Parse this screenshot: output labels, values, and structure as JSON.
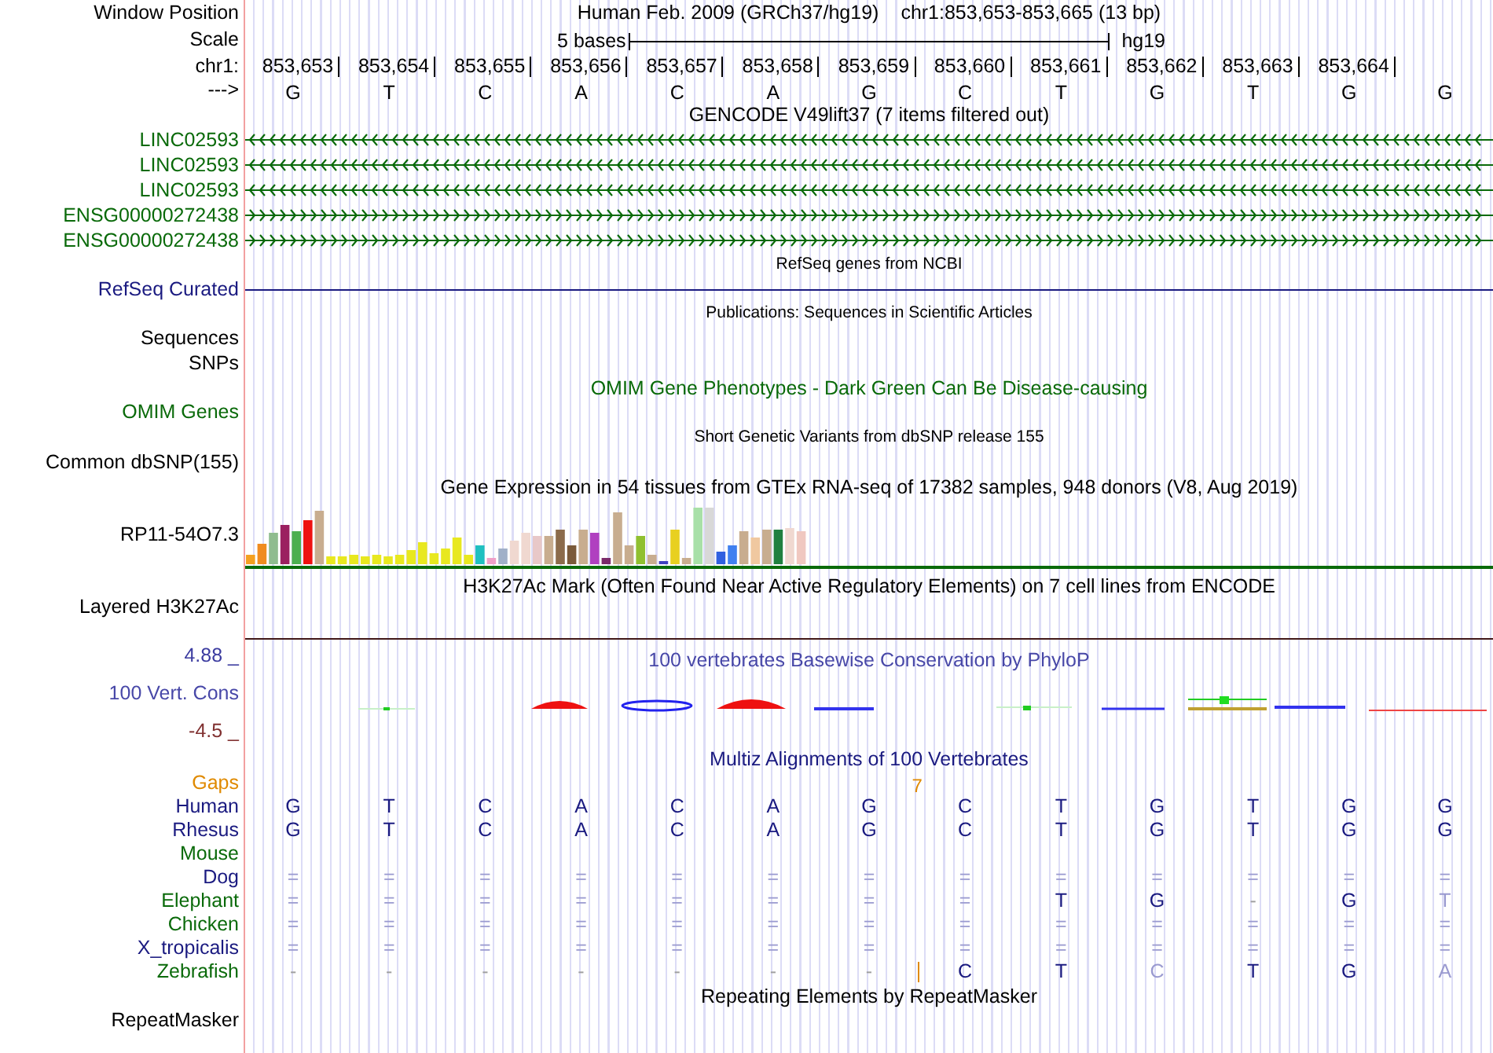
{
  "header": {
    "window_label": "Window Position",
    "assembly": "Human Feb. 2009 (GRCh37/hg19)",
    "position": "chr1:853,653-853,665 (13 bp)",
    "scale_label": "Scale",
    "scale_text": "5 bases",
    "scale_db": "hg19",
    "chrom_label": "chr1:",
    "positions": [
      "853,653",
      "853,654",
      "853,655",
      "853,656",
      "853,657",
      "853,658",
      "853,659",
      "853,660",
      "853,661",
      "853,662",
      "853,663",
      "853,664"
    ],
    "strand_label": "--->",
    "bases": [
      "G",
      "T",
      "C",
      "A",
      "C",
      "A",
      "G",
      "C",
      "T",
      "G",
      "T",
      "G",
      "G"
    ]
  },
  "rows": [
    {
      "kind": "title",
      "text": "GENCODE V49lift37 (7 items filtered out)",
      "small": false,
      "color": "#000000"
    },
    {
      "kind": "gene",
      "label": "LINC02593",
      "color": "#0a6a0a",
      "reverse": true
    },
    {
      "kind": "gene",
      "label": "LINC02593",
      "color": "#0a6a0a",
      "reverse": true
    },
    {
      "kind": "gene",
      "label": "LINC02593",
      "color": "#0a6a0a",
      "reverse": true
    },
    {
      "kind": "gene",
      "label": "ENSG00000272438",
      "color": "#0a6a0a",
      "reverse": false
    },
    {
      "kind": "gene",
      "label": "ENSG00000272438",
      "color": "#0a6a0a",
      "reverse": false
    },
    {
      "kind": "title",
      "text": "RefSeq genes from NCBI",
      "small": true,
      "color": "#000000"
    },
    {
      "kind": "line",
      "label": "RefSeq Curated",
      "color": "#1a1a80"
    },
    {
      "kind": "title",
      "text": "Publications: Sequences in Scientific Articles",
      "small": true,
      "color": "#000000"
    },
    {
      "kind": "label",
      "label": "Sequences",
      "color": "#000000"
    },
    {
      "kind": "label",
      "label": "SNPs",
      "color": "#000000"
    },
    {
      "kind": "title",
      "text": "OMIM Gene Phenotypes - Dark Green Can Be Disease-causing",
      "small": false,
      "color": "#0a6a0a"
    },
    {
      "kind": "label",
      "label": "OMIM Genes",
      "color": "#0a6a0a"
    },
    {
      "kind": "title",
      "text": "Short Genetic Variants from dbSNP release 155",
      "small": true,
      "color": "#000000"
    },
    {
      "kind": "label",
      "label": "Common dbSNP(155)",
      "color": "#000000"
    },
    {
      "kind": "title",
      "text": "Gene Expression in 54 tissues from GTEx RNA-seq of 17382 samples, 948 donors (V8, Aug 2019)",
      "small": false,
      "color": "#000000"
    },
    {
      "kind": "expression",
      "label": "RP11-54O7.3"
    },
    {
      "kind": "layered",
      "label": "Layered H3K27Ac",
      "title": "H3K27Ac Mark (Often Found Near Active Regulatory Elements) on 7 cell lines from ENCODE"
    },
    {
      "kind": "conservation",
      "max": "4.88 _",
      "label": "100 Vert. Cons",
      "min": "-4.5 _",
      "title": "100 vertebrates Basewise Conservation by PhyloP"
    },
    {
      "kind": "title",
      "text": "Multiz Alignments of 100 Vertebrates",
      "small": false,
      "color": "#1a1a80"
    },
    {
      "kind": "gaps",
      "label": "Gaps",
      "text": "7",
      "color": "#e08a00"
    },
    {
      "kind": "alignment",
      "label": "Human",
      "color": "#1a1a80",
      "cells": [
        {
          "text": "G",
          "kind": "base"
        },
        {
          "text": "T",
          "kind": "base"
        },
        {
          "text": "C",
          "kind": "base"
        },
        {
          "text": "A",
          "kind": "base"
        },
        {
          "text": "C",
          "kind": "base"
        },
        {
          "text": "A",
          "kind": "base"
        },
        {
          "text": "G",
          "kind": "base"
        },
        {
          "text": "C",
          "kind": "base"
        },
        {
          "text": "T",
          "kind": "base"
        },
        {
          "text": "G",
          "kind": "base"
        },
        {
          "text": "T",
          "kind": "base"
        },
        {
          "text": "G",
          "kind": "base"
        },
        {
          "text": "G",
          "kind": "base"
        }
      ]
    },
    {
      "kind": "alignment",
      "label": "Rhesus",
      "color": "#1a1a80",
      "cells": [
        {
          "text": "G",
          "kind": "base"
        },
        {
          "text": "T",
          "kind": "base"
        },
        {
          "text": "C",
          "kind": "base"
        },
        {
          "text": "A",
          "kind": "base"
        },
        {
          "text": "C",
          "kind": "base"
        },
        {
          "text": "A",
          "kind": "base"
        },
        {
          "text": "G",
          "kind": "base"
        },
        {
          "text": "C",
          "kind": "base"
        },
        {
          "text": "T",
          "kind": "base"
        },
        {
          "text": "G",
          "kind": "base"
        },
        {
          "text": "T",
          "kind": "base"
        },
        {
          "text": "G",
          "kind": "base"
        },
        {
          "text": "G",
          "kind": "base"
        }
      ]
    },
    {
      "kind": "alignment",
      "label": "Mouse",
      "color": "#0a6a0a"
    },
    {
      "kind": "alignment",
      "label": "Dog",
      "color": "#1a1a80",
      "cells": [
        {
          "text": "=",
          "kind": "match"
        },
        {
          "text": "=",
          "kind": "match"
        },
        {
          "text": "=",
          "kind": "match"
        },
        {
          "text": "=",
          "kind": "match"
        },
        {
          "text": "=",
          "kind": "match"
        },
        {
          "text": "=",
          "kind": "match"
        },
        {
          "text": "=",
          "kind": "match"
        },
        {
          "text": "=",
          "kind": "match"
        },
        {
          "text": "=",
          "kind": "match"
        },
        {
          "text": "=",
          "kind": "match"
        },
        {
          "text": "=",
          "kind": "match"
        },
        {
          "text": "=",
          "kind": "match"
        },
        {
          "text": "=",
          "kind": "match"
        }
      ]
    },
    {
      "kind": "alignment",
      "label": "Elephant",
      "color": "#0a6a0a",
      "cells": [
        {
          "text": "=",
          "kind": "match"
        },
        {
          "text": "=",
          "kind": "match"
        },
        {
          "text": "=",
          "kind": "match"
        },
        {
          "text": "=",
          "kind": "match"
        },
        {
          "text": "=",
          "kind": "match"
        },
        {
          "text": "=",
          "kind": "match"
        },
        {
          "text": "=",
          "kind": "match"
        },
        {
          "text": "=",
          "kind": "match"
        },
        {
          "text": "T",
          "kind": "base"
        },
        {
          "text": "G",
          "kind": "base"
        },
        {
          "text": "-",
          "kind": "gap"
        },
        {
          "text": "G",
          "kind": "base"
        },
        {
          "text": "T",
          "kind": "faded"
        }
      ]
    },
    {
      "kind": "alignment",
      "label": "Chicken",
      "color": "#0a6a0a",
      "cells": [
        {
          "text": "=",
          "kind": "match"
        },
        {
          "text": "=",
          "kind": "match"
        },
        {
          "text": "=",
          "kind": "match"
        },
        {
          "text": "=",
          "kind": "match"
        },
        {
          "text": "=",
          "kind": "match"
        },
        {
          "text": "=",
          "kind": "match"
        },
        {
          "text": "=",
          "kind": "match"
        },
        {
          "text": "=",
          "kind": "match"
        },
        {
          "text": "=",
          "kind": "match"
        },
        {
          "text": "=",
          "kind": "match"
        },
        {
          "text": "=",
          "kind": "match"
        },
        {
          "text": "=",
          "kind": "match"
        },
        {
          "text": "=",
          "kind": "match"
        }
      ]
    },
    {
      "kind": "alignment",
      "label": "X_tropicalis",
      "color": "#1a1a80",
      "cells": [
        {
          "text": "=",
          "kind": "match"
        },
        {
          "text": "=",
          "kind": "match"
        },
        {
          "text": "=",
          "kind": "match"
        },
        {
          "text": "=",
          "kind": "match"
        },
        {
          "text": "=",
          "kind": "match"
        },
        {
          "text": "=",
          "kind": "match"
        },
        {
          "text": "=",
          "kind": "match"
        },
        {
          "text": "=",
          "kind": "match"
        },
        {
          "text": "=",
          "kind": "match"
        },
        {
          "text": "=",
          "kind": "match"
        },
        {
          "text": "=",
          "kind": "match"
        },
        {
          "text": "=",
          "kind": "match"
        },
        {
          "text": "=",
          "kind": "match"
        }
      ]
    },
    {
      "kind": "alignment",
      "label": "Zebrafish",
      "color": "#0a6a0a",
      "insertion": true,
      "cells": [
        {
          "text": "-",
          "kind": "gap"
        },
        {
          "text": "-",
          "kind": "gap"
        },
        {
          "text": "-",
          "kind": "gap"
        },
        {
          "text": "-",
          "kind": "gap"
        },
        {
          "text": "-",
          "kind": "gap"
        },
        {
          "text": "-",
          "kind": "gap"
        },
        {
          "text": "-",
          "kind": "gap"
        },
        {
          "text": "C",
          "kind": "base"
        },
        {
          "text": "T",
          "kind": "base"
        },
        {
          "text": "C",
          "kind": "faded"
        },
        {
          "text": "T",
          "kind": "base"
        },
        {
          "text": "G",
          "kind": "base"
        },
        {
          "text": "A",
          "kind": "faded"
        }
      ]
    },
    {
      "kind": "title",
      "text": "Repeating Elements by RepeatMasker",
      "small": false,
      "color": "#000000"
    },
    {
      "kind": "label",
      "label": "RepeatMasker",
      "color": "#000000"
    }
  ]
}
